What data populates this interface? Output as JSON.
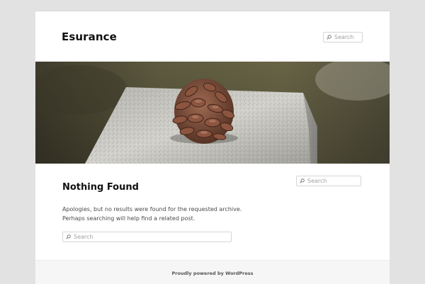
{
  "site": {
    "title": "Esurance"
  },
  "header_search": {
    "placeholder": "Search"
  },
  "hero": {
    "alt": "pine cone resting on a granite post"
  },
  "main": {
    "title": "Nothing Found",
    "message": "Apologies, but no results were found for the requested archive. Perhaps searching will help find a related post.",
    "search_placeholder": "Search"
  },
  "sidebar": {
    "search_placeholder": "Search"
  },
  "footer": {
    "credit": "Proudly powered by WordPress"
  },
  "colors": {
    "background": "#e2e2e2",
    "page": "#ffffff",
    "footer": "#f6f6f6",
    "title": "#111111"
  },
  "icons": {
    "search": "magnifier-icon"
  }
}
